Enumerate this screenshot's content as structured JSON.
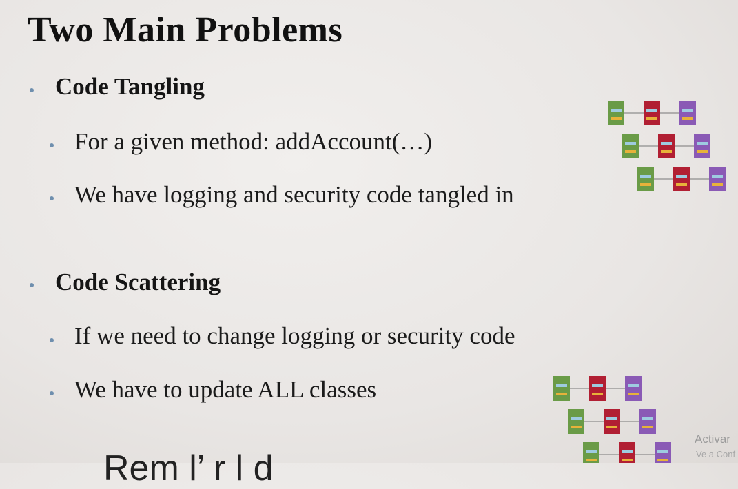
{
  "slide": {
    "title": "Two Main Problems",
    "sections": [
      {
        "heading": "Code Tangling",
        "items": [
          "For a given method: addAccount(…)",
          "We have logging and security code tangled in"
        ]
      },
      {
        "heading": "Code Scattering",
        "items": [
          "If we need to change logging or security code",
          "We have to update ALL classes"
        ]
      }
    ],
    "colors": {
      "bullet": "#6f8fae",
      "box_green": "#6a9b47",
      "box_red": "#b11f33",
      "box_purple": "#8a5ab5"
    }
  },
  "overlay": {
    "partial_text": "Rem  l’       r     l     d"
  },
  "watermark": {
    "line1": "Activar",
    "line2": "Ve a Conf"
  }
}
